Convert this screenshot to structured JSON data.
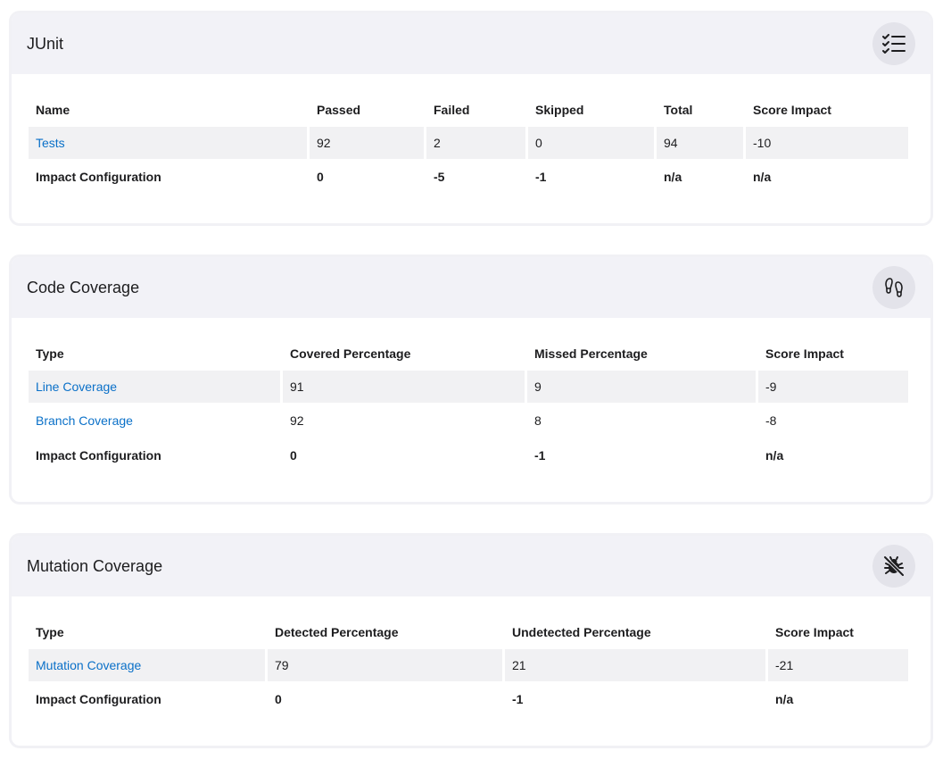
{
  "junit": {
    "title": "JUnit",
    "icon": "checklist-icon",
    "headers": [
      "Name",
      "Passed",
      "Failed",
      "Skipped",
      "Total",
      "Score Impact"
    ],
    "rows": [
      [
        "Tests",
        "92",
        "2",
        "0",
        "94",
        "-10"
      ],
      [
        "Impact Configuration",
        "0",
        "-5",
        "-1",
        "n/a",
        "n/a"
      ]
    ]
  },
  "coverage": {
    "title": "Code Coverage",
    "icon": "footprints-icon",
    "headers": [
      "Type",
      "Covered Percentage",
      "Missed Percentage",
      "Score Impact"
    ],
    "rows": [
      [
        "Line Coverage",
        "91",
        "9",
        "-9"
      ],
      [
        "Branch Coverage",
        "92",
        "8",
        "-8"
      ],
      [
        "Impact Configuration",
        "0",
        "-1",
        "n/a"
      ]
    ]
  },
  "mutation": {
    "title": "Mutation Coverage",
    "icon": "bug-off-icon",
    "headers": [
      "Type",
      "Detected Percentage",
      "Undetected Percentage",
      "Score Impact"
    ],
    "rows": [
      [
        "Mutation Coverage",
        "79",
        "21",
        "-21"
      ],
      [
        "Impact Configuration",
        "0",
        "-1",
        "n/a"
      ]
    ]
  },
  "colors": {
    "link": "#0a70c8",
    "header_bg": "#f2f2f7",
    "row_bg": "#f1f1f3"
  }
}
